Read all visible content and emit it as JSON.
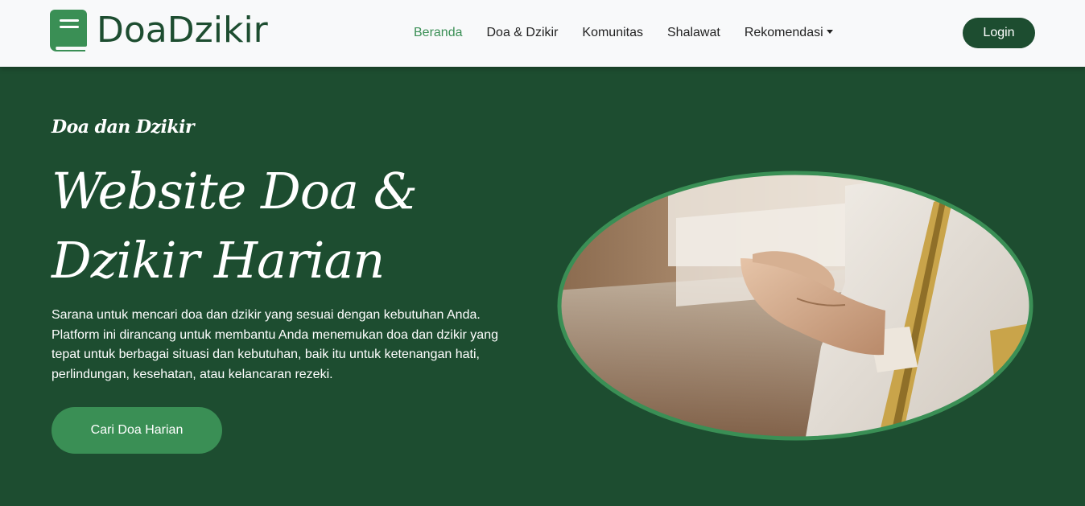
{
  "brand": {
    "name": "DoaDzikir",
    "icon": "book-icon"
  },
  "nav": {
    "items": [
      {
        "label": "Beranda",
        "active": true
      },
      {
        "label": "Doa & Dzikir",
        "active": false
      },
      {
        "label": "Komunitas",
        "active": false
      },
      {
        "label": "Shalawat",
        "active": false
      },
      {
        "label": "Rekomendasi",
        "active": false,
        "dropdown": true
      }
    ],
    "login_label": "Login"
  },
  "hero": {
    "eyebrow": "Doa dan Dzikir",
    "headline": "Website Doa & Dzikir Harian",
    "description": "Sarana untuk mencari doa dan dzikir yang sesuai dengan kebutuhan Anda. Platform ini dirancang untuk membantu Anda menemukan doa dan dzikir yang tepat untuk berbagai situasi dan kebutuhan, baik itu untuk ketenangan hati, perlindungan, kesehatan, atau kelancaran rezeki.",
    "cta_label": "Cari Doa Harian",
    "image": "praying-hands-photo"
  },
  "colors": {
    "primary_dark": "#1d4d30",
    "accent_green": "#3a8f55",
    "navbar_bg": "#f8f9fa"
  }
}
